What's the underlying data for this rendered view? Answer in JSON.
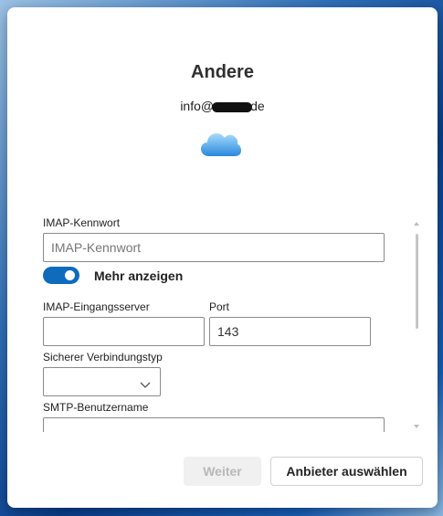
{
  "dialog": {
    "title": "Andere",
    "email_prefix": "info@",
    "email_suffix": "de"
  },
  "form": {
    "imap_password_label": "IMAP-Kennwort",
    "imap_password_placeholder": "IMAP-Kennwort",
    "show_more_label": "Mehr anzeigen",
    "show_more_on": true,
    "imap_server_label": "IMAP-Eingangsserver",
    "imap_server_value": "",
    "port_label": "Port",
    "port_value": "143",
    "connection_type_label": "Sicherer Verbindungstyp",
    "connection_type_value": "",
    "smtp_username_label": "SMTP-Benutzername",
    "smtp_username_value": ""
  },
  "buttons": {
    "next_label": "Weiter",
    "choose_provider_label": "Anbieter auswählen"
  },
  "colors": {
    "accent": "#0f6cbd",
    "cloud_light": "#9fd6fa",
    "cloud_dark": "#2f8fe0"
  }
}
